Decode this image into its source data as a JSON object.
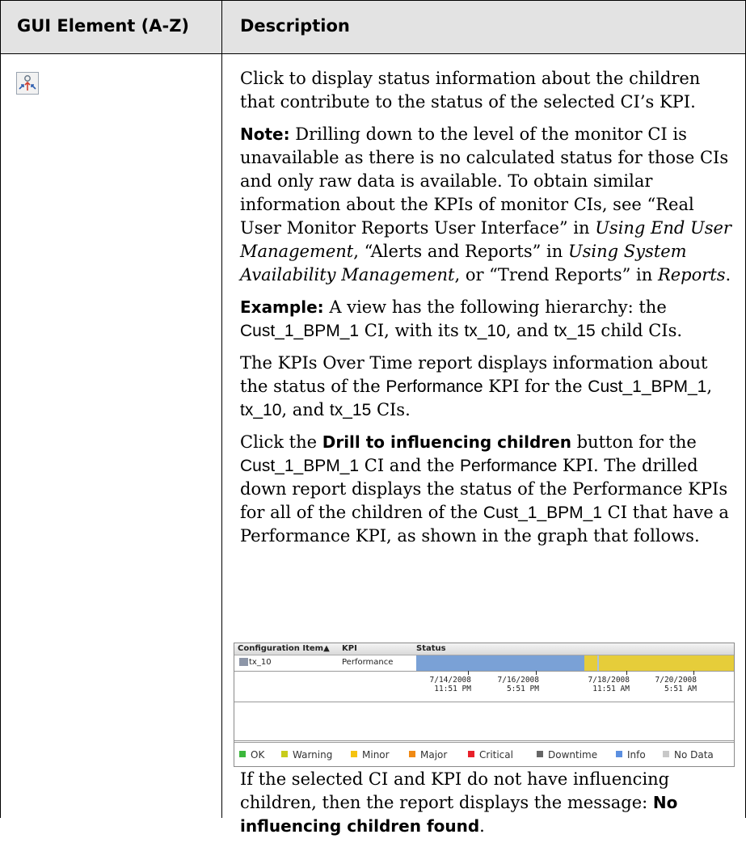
{
  "table": {
    "col1_header": "GUI Element (A-Z)",
    "col2_header": "Description"
  },
  "row": {
    "icon_name": "drill-to-influencing-children-icon",
    "p1": "Click to display status information about the children that contribute to the status of the selected CI’s KPI.",
    "note_label": "Note:",
    "note_a": " Drilling down to the level of the monitor CI is unavailable as there is no calculated status for those CIs and only raw data is available. To obtain similar information about the KPIs of monitor CIs, see “Real User Monitor Reports User Interface” in ",
    "note_ital1": "Using End User Management",
    "note_b": ", “Alerts and Reports” in ",
    "note_ital2": "Using System Availability Management",
    "note_c": ", or “Trend Reports” in ",
    "note_ital3": "Reports",
    "note_d": ".",
    "ex_label": "Example:",
    "ex_a": " A view has the following hierarchy: the ",
    "ex_ci": "Cust_1_BPM_1",
    "ex_b": " CI, with its ",
    "ex_tx10": "tx_10",
    "ex_c": ", and ",
    "ex_tx15": "tx_15",
    "ex_d": " child CIs.",
    "p4_a": "The KPIs Over Time report displays information about the status of the ",
    "p4_perf": "Performance",
    "p4_b": " KPI for the ",
    "p4_ci": "Cust_1_BPM_1",
    "p4_c": ", ",
    "p4_tx10": "tx_10",
    "p4_d": ", and ",
    "p4_tx15": "tx_15",
    "p4_e": " CIs.",
    "p5_a": "Click the ",
    "p5_bold": "Drill to influencing children",
    "p5_b": " button for the ",
    "p5_ci": "Cust_1_BPM_1",
    "p5_c": " CI and the ",
    "p5_perf": "Performance",
    "p5_d": " KPI. The drilled down report displays the status of the Performance KPIs for all of the children of the ",
    "p5_ci2": "Cust_1_BPM_1",
    "p5_e": " CI that have a Performance KPI, as shown in the graph that follows.",
    "p6_a": "If the selected CI and KPI do not have influencing children, then the report displays the message: ",
    "p6_bold": "No influencing children found",
    "p6_b": "."
  },
  "report": {
    "col_ci": "Configuration Item▲",
    "col_kpi": "KPI",
    "col_status": "Status",
    "row_ci": "tx_10",
    "row_kpi": "Performance",
    "ticks": [
      {
        "date": "7/14/2008",
        "time": "11:51 PM"
      },
      {
        "date": "7/16/2008",
        "time": "5:51 PM"
      },
      {
        "date": "7/18/2008",
        "time": "11:51 AM"
      },
      {
        "date": "7/20/2008",
        "time": "5:51 AM"
      }
    ],
    "legend": [
      {
        "label": "OK",
        "color": "#3cb83c"
      },
      {
        "label": "Warning",
        "color": "#c8cc1a"
      },
      {
        "label": "Minor",
        "color": "#f5c30f"
      },
      {
        "label": "Major",
        "color": "#f08a14"
      },
      {
        "label": "Critical",
        "color": "#e8202a"
      },
      {
        "label": "Downtime",
        "color": "#666666"
      },
      {
        "label": "Info",
        "color": "#5b8fe0"
      },
      {
        "label": "No Data",
        "color": "#c8c8c8"
      }
    ]
  }
}
